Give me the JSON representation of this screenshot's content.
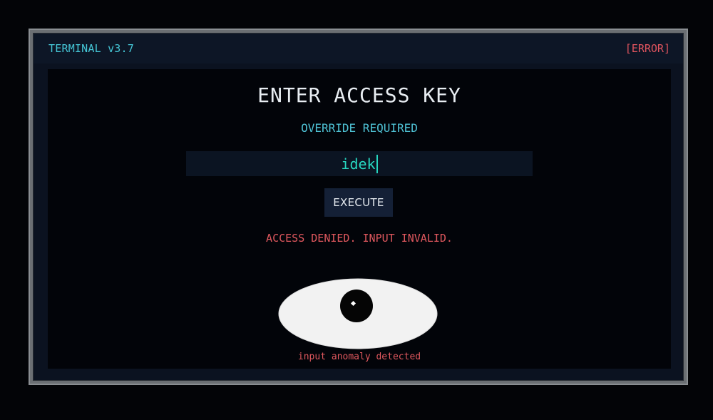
{
  "window": {
    "title": "TERMINAL v3.7",
    "status": "[ERROR]"
  },
  "prompt": {
    "heading": "ENTER ACCESS KEY",
    "subheading": "OVERRIDE REQUIRED"
  },
  "key_input": {
    "value": "idek"
  },
  "execute_label": "EXECUTE",
  "error_message": "ACCESS DENIED. INPUT INVALID.",
  "eye": {
    "icon": "eye-icon"
  },
  "anomaly_message": "input anomaly detected",
  "colors": {
    "accent": "#45c6d6",
    "error": "#e0545e",
    "input_text": "#27d6c0"
  }
}
